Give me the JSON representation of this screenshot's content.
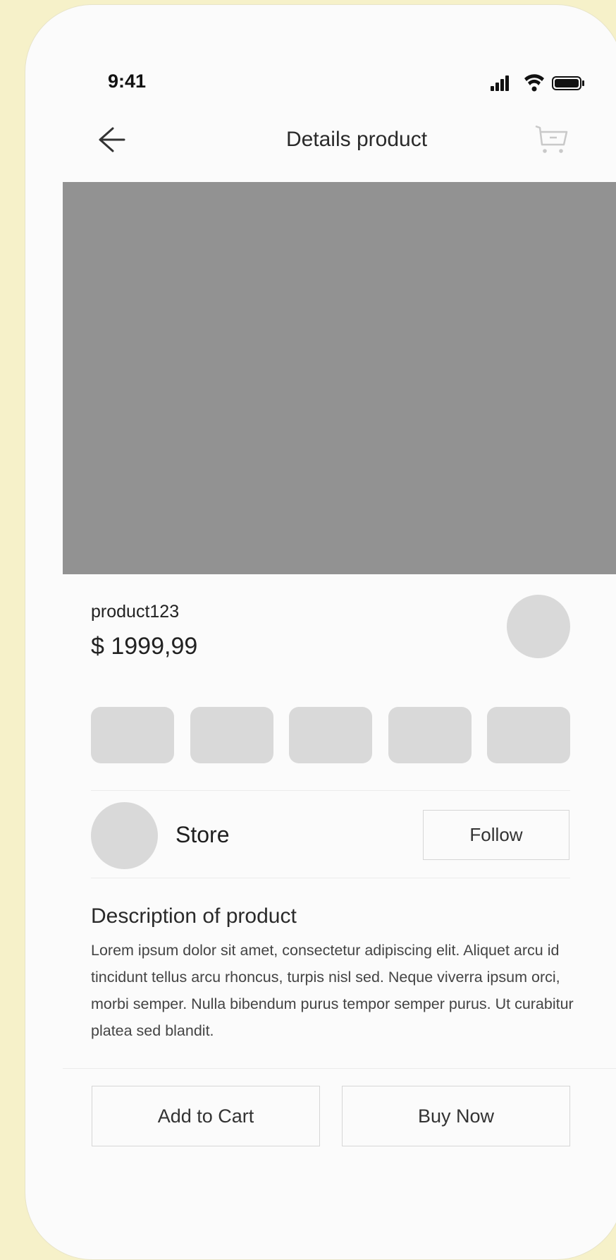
{
  "status_bar": {
    "time": "9:41",
    "icons": [
      "signal-icon",
      "wifi-icon",
      "battery-icon"
    ]
  },
  "header": {
    "title": "Details product",
    "back_icon": "arrow-left-icon",
    "cart_icon": "cart-icon"
  },
  "product": {
    "name": "product123",
    "price": "$ 1999,99",
    "thumbnail_count": 5
  },
  "store": {
    "name": "Store",
    "follow_label": "Follow"
  },
  "description": {
    "title": "Description of product",
    "text": "Lorem ipsum dolor sit amet, consectetur adipiscing elit. Aliquet arcu id tincidunt tellus arcu rhoncus, turpis nisl sed. Neque viverra ipsum orci, morbi semper. Nulla bibendum purus tempor semper purus. Ut curabitur platea sed blandit."
  },
  "actions": {
    "add_to_cart": "Add to Cart",
    "buy_now": "Buy Now"
  },
  "colors": {
    "background": "#f6f1c9",
    "screen": "#fbfbfb",
    "image_placeholder": "#929292",
    "placeholder_light": "#d9d9d9",
    "border": "#d6d6d6"
  }
}
